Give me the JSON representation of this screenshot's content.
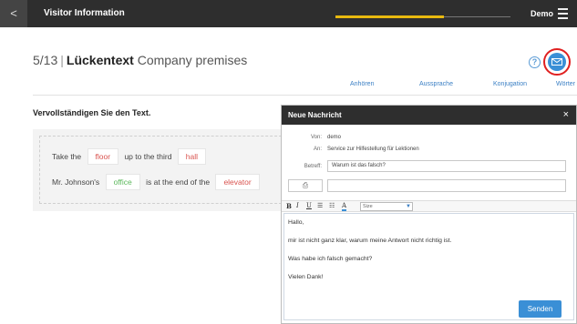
{
  "topbar": {
    "back_symbol": "<",
    "title": "Visitor Information",
    "progress": 0.62,
    "user": "Demo"
  },
  "heading": {
    "counter": "5/13",
    "type": "Lückentext",
    "topic": "Company premises"
  },
  "tabs": [
    "Anhören",
    "Aussprache",
    "Konjugation",
    "Wörter"
  ],
  "exercise": {
    "instruction": "Vervollständigen Sie den Text.",
    "line1": {
      "before": "Take the",
      "gap1": "floor",
      "middle": "up to the third",
      "gap2": "hall"
    },
    "line2": {
      "before": "Mr. Johnson's",
      "gap1": "office",
      "middle": "is at the end of the",
      "gap2": "elevator"
    }
  },
  "dialog": {
    "title": "Neue Nachricht",
    "close_symbol": "×",
    "from_label": "Von:",
    "from_value": "demo",
    "to_label": "An:",
    "to_value": "Service zur Hilfestellung für Lektionen",
    "subject_label": "Betreff:",
    "subject_value": "Warum ist das falsch?",
    "toolbar": {
      "bold": "B",
      "italic": "I",
      "underline": "U",
      "size_placeholder": "Size"
    },
    "body_lines": [
      "Hallo,",
      "mir ist nicht ganz klar, warum meine Antwort nicht richtig ist.",
      "Was habe ich falsch gemacht?",
      "Vielen Dank!"
    ],
    "send_label": "Senden"
  },
  "colors": {
    "accent": "#3a8fd6",
    "topbar": "#2e2e2e",
    "progress": "#e8b90f",
    "wrong": "#d9534f",
    "correct": "#5cb85c",
    "highlight_ring": "#e02020"
  }
}
